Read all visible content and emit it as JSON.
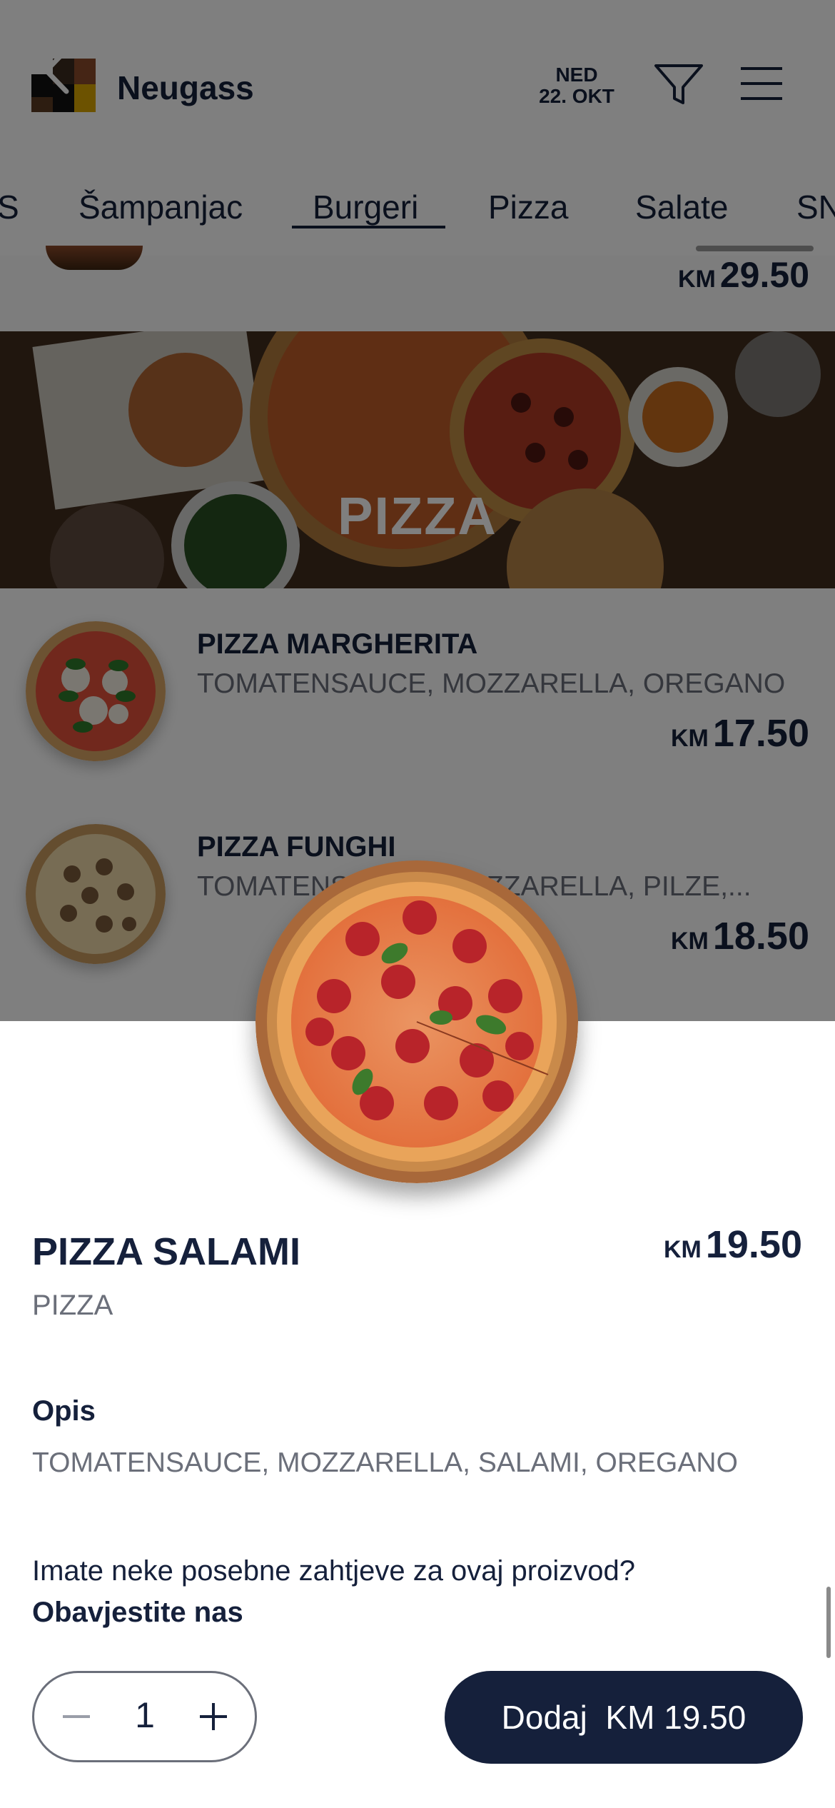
{
  "header": {
    "brand": "Neugass",
    "date_line1": "NED",
    "date_line2": "22. OKT"
  },
  "tabs": [
    {
      "label": "S"
    },
    {
      "label": "Šampanjac"
    },
    {
      "label": "Burgeri"
    },
    {
      "label": "Pizza"
    },
    {
      "label": "Salate"
    },
    {
      "label": "SN"
    }
  ],
  "active_tab": "Burgeri",
  "previous_item": {
    "currency": "KM",
    "price": "29.50"
  },
  "section": {
    "title": "PIZZA"
  },
  "items": [
    {
      "name": "PIZZA MARGHERITA",
      "description": "TOMATENSAUCE, MOZZARELLA, OREGANO",
      "currency": "KM",
      "price": "17.50"
    },
    {
      "name": "PIZZA FUNGHI",
      "description": "TOMATENSAUCE, MOZZARELLA, PILZE,...",
      "currency": "KM",
      "price": "18.50"
    }
  ],
  "sheet": {
    "title": "PIZZA SALAMI",
    "category": "PIZZA",
    "currency": "KM",
    "price": "19.50",
    "description_label": "Opis",
    "description": "TOMATENSAUCE, MOZZARELLA, SALAMI, OREGANO",
    "request_text": "Imate neke posebne zahtjeve za ovaj proizvod?",
    "request_link": "Obavjestite nas",
    "quantity": "1",
    "add_button": "Dodaj  KM 19.50"
  },
  "colors": {
    "accent": "#15203b",
    "muted": "#6b6f7a"
  }
}
